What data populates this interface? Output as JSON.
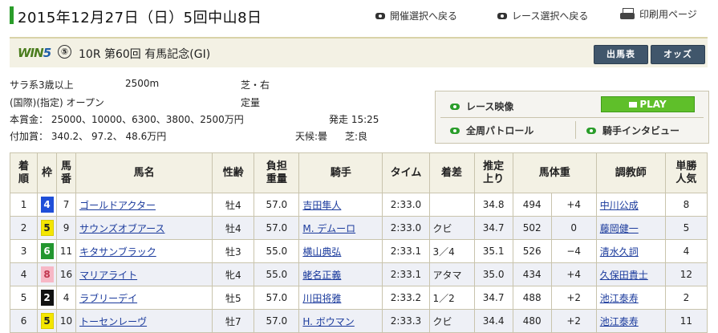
{
  "header": {
    "date_title": "2015年12月27日（日）5回中山8日",
    "links": [
      "開催選択へ戻る",
      "レース選択へ戻る",
      "印刷用ページ"
    ]
  },
  "race": {
    "win5_label": "WIN5",
    "win5_leg": "⑤",
    "title": "10R 第60回 有馬記念(GI)",
    "buttons": [
      "出馬表",
      "オッズ"
    ]
  },
  "info": {
    "class": "サラ系3歳以上",
    "distance": "2500m",
    "surface": "芝・右",
    "conditions": "(国際)(指定) オープン",
    "weight_rule": "定量",
    "prize": "本賞金： 25000、10000、6300、3800、2500万円",
    "post_time": "発走 15:25",
    "add_prize": "付加賞：  340.2、 97.2、 48.6万円",
    "weather": "天候:曇",
    "going": "芝:良"
  },
  "video": {
    "race_video": "レース映像",
    "play": "PLAY",
    "patrol": "全周パトロール",
    "interview": "騎手インタビュー"
  },
  "table": {
    "headers": [
      "着\n順",
      "枠",
      "馬\n番",
      "馬名",
      "性齢",
      "負担\n重量",
      "騎手",
      "タイム",
      "着差",
      "推定\n上り",
      "馬体重",
      "調教師",
      "単勝\n人気"
    ],
    "rows": [
      {
        "pos": "1",
        "waku": "4",
        "num": "7",
        "horse": "ゴールドアクター",
        "sexage": "牡4",
        "weight": "57.0",
        "jockey": "吉田隼人",
        "time": "2:33.0",
        "margin": "",
        "last3f": "34.8",
        "body": "494",
        "diff": "+4",
        "trainer": "中川公成",
        "pop": "8"
      },
      {
        "pos": "2",
        "waku": "5",
        "num": "9",
        "horse": "サウンズオブアース",
        "sexage": "牡4",
        "weight": "57.0",
        "jockey": "M. デムーロ",
        "time": "2:33.0",
        "margin": "クビ",
        "last3f": "34.7",
        "body": "502",
        "diff": "0",
        "trainer": "藤岡健一",
        "pop": "5"
      },
      {
        "pos": "3",
        "waku": "6",
        "num": "11",
        "horse": "キタサンブラック",
        "sexage": "牡3",
        "weight": "55.0",
        "jockey": "横山典弘",
        "time": "2:33.1",
        "margin": "3／4",
        "last3f": "35.1",
        "body": "526",
        "diff": "−4",
        "trainer": "清水久詞",
        "pop": "4"
      },
      {
        "pos": "4",
        "waku": "8",
        "num": "16",
        "horse": "マリアライト",
        "sexage": "牝4",
        "weight": "55.0",
        "jockey": "蛯名正義",
        "time": "2:33.1",
        "margin": "アタマ",
        "last3f": "35.0",
        "body": "434",
        "diff": "+4",
        "trainer": "久保田貴士",
        "pop": "12"
      },
      {
        "pos": "5",
        "waku": "2",
        "num": "4",
        "horse": "ラブリーデイ",
        "sexage": "牡5",
        "weight": "57.0",
        "jockey": "川田将雅",
        "time": "2:33.2",
        "margin": "1／2",
        "last3f": "34.7",
        "body": "488",
        "diff": "+2",
        "trainer": "池江泰寿",
        "pop": "2"
      },
      {
        "pos": "6",
        "waku": "5",
        "num": "10",
        "horse": "トーセンレーヴ",
        "sexage": "牡7",
        "weight": "57.0",
        "jockey": "H. ボウマン",
        "time": "2:33.3",
        "margin": "クビ",
        "last3f": "34.4",
        "body": "480",
        "diff": "+2",
        "trainer": "池江泰寿",
        "pop": "11"
      }
    ]
  },
  "waku_colors": {
    "1": {
      "bg": "#ffffff",
      "fg": "#000000",
      "border": "#999999"
    },
    "2": {
      "bg": "#111111",
      "fg": "#ffffff",
      "border": "#111111"
    },
    "3": {
      "bg": "#e8352b",
      "fg": "#ffffff",
      "border": "#e8352b"
    },
    "4": {
      "bg": "#1f4fd8",
      "fg": "#ffffff",
      "border": "#1f4fd8"
    },
    "5": {
      "bg": "#f4e600",
      "fg": "#222222",
      "border": "#d8cc00"
    },
    "6": {
      "bg": "#23962f",
      "fg": "#ffffff",
      "border": "#23962f"
    },
    "7": {
      "bg": "#f29b20",
      "fg": "#222222",
      "border": "#f29b20"
    },
    "8": {
      "bg": "#f7b8c6",
      "fg": "#c0354f",
      "border": "#f7b8c6"
    }
  }
}
